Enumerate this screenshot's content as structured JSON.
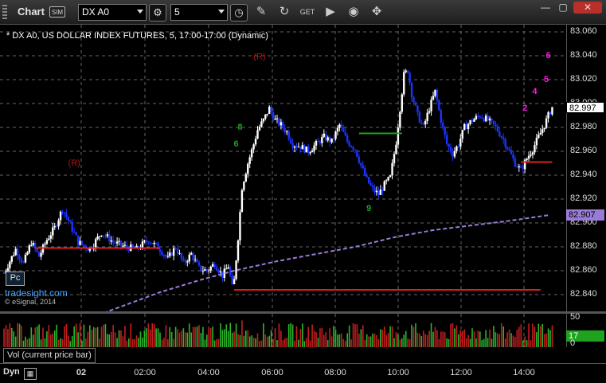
{
  "toolbar": {
    "title": "Chart",
    "sim_badge": "SIM",
    "symbol": "DX A0",
    "interval": "5",
    "icons": [
      "grip-icon",
      "settings-icon",
      "time-template-icon",
      "draw-tool-icon",
      "link-icon",
      "get-icon",
      "play-icon",
      "nav-icon",
      "drag-icon"
    ],
    "window_controls": [
      "minimize-icon",
      "maximize-icon",
      "close-icon"
    ]
  },
  "chart_data": {
    "type": "candlestick",
    "title": "* DX A0, US DOLLAR INDEX FUTURES, 5, 17:00-17:00 (Dynamic)",
    "ylim": [
      82.826,
      83.066
    ],
    "yticks": [
      "83.060",
      "83.040",
      "83.020",
      "83.000",
      "82.980",
      "82.960",
      "82.940",
      "82.920",
      "82.900",
      "82.880",
      "82.860",
      "82.840"
    ],
    "xticks": [
      "02",
      "02:00",
      "04:00",
      "06:00",
      "08:00",
      "10:00",
      "12:00",
      "14:00"
    ],
    "last_price": "82.997",
    "ma_label": "82.907",
    "grid": true,
    "colors": {
      "up": "#ffffff",
      "down": "#1a33ff",
      "ma": "#9a7bd8",
      "support": "#e01c1c",
      "count_green": "#1fa31f",
      "count_magenta": "#ff1ae8",
      "marker_red": "#b01313"
    },
    "price_path": [
      [
        0,
        82.858
      ],
      [
        6,
        82.878
      ],
      [
        10,
        82.866
      ],
      [
        14,
        82.884
      ],
      [
        18,
        82.872
      ],
      [
        22,
        82.886
      ],
      [
        26,
        82.896
      ],
      [
        30,
        82.912
      ],
      [
        33,
        82.902
      ],
      [
        38,
        82.884
      ],
      [
        44,
        82.878
      ],
      [
        50,
        82.892
      ],
      [
        56,
        82.884
      ],
      [
        62,
        82.88
      ],
      [
        68,
        82.878
      ],
      [
        74,
        82.886
      ],
      [
        80,
        82.878
      ],
      [
        84,
        82.87
      ],
      [
        88,
        82.88
      ],
      [
        92,
        82.866
      ],
      [
        96,
        82.874
      ],
      [
        100,
        82.862
      ],
      [
        104,
        82.86
      ],
      [
        108,
        82.866
      ],
      [
        112,
        82.856
      ],
      [
        115,
        82.864
      ],
      [
        117,
        82.846
      ],
      [
        118,
        82.852
      ],
      [
        120,
        82.888
      ],
      [
        122,
        82.93
      ],
      [
        125,
        82.95
      ],
      [
        128,
        82.966
      ],
      [
        130,
        82.978
      ],
      [
        133,
        82.986
      ],
      [
        136,
        82.996
      ],
      [
        139,
        82.986
      ],
      [
        142,
        82.982
      ],
      [
        145,
        82.976
      ],
      [
        148,
        82.966
      ],
      [
        152,
        82.964
      ],
      [
        156,
        82.96
      ],
      [
        160,
        82.966
      ],
      [
        164,
        82.972
      ],
      [
        168,
        82.968
      ],
      [
        172,
        82.982
      ],
      [
        176,
        82.968
      ],
      [
        180,
        82.962
      ],
      [
        183,
        82.948
      ],
      [
        186,
        82.936
      ],
      [
        189,
        82.928
      ],
      [
        192,
        82.924
      ],
      [
        195,
        82.932
      ],
      [
        198,
        82.938
      ],
      [
        201,
        82.968
      ],
      [
        203,
        82.996
      ],
      [
        205,
        83.024
      ],
      [
        207,
        83.028
      ],
      [
        209,
        83.008
      ],
      [
        212,
        82.99
      ],
      [
        215,
        82.98
      ],
      [
        218,
        82.996
      ],
      [
        221,
        83.01
      ],
      [
        224,
        82.986
      ],
      [
        227,
        82.966
      ],
      [
        230,
        82.958
      ],
      [
        233,
        82.966
      ],
      [
        236,
        82.98
      ],
      [
        240,
        82.986
      ],
      [
        244,
        82.99
      ],
      [
        248,
        82.986
      ],
      [
        252,
        82.98
      ],
      [
        256,
        82.97
      ],
      [
        259,
        82.96
      ],
      [
        262,
        82.95
      ],
      [
        265,
        82.944
      ],
      [
        268,
        82.954
      ],
      [
        271,
        82.962
      ],
      [
        274,
        82.972
      ],
      [
        277,
        82.982
      ],
      [
        279,
        82.99
      ],
      [
        281,
        82.997
      ]
    ],
    "moving_average": [
      [
        0,
        82.808
      ],
      [
        20,
        82.812
      ],
      [
        40,
        82.818
      ],
      [
        60,
        82.83
      ],
      [
        80,
        82.842
      ],
      [
        100,
        82.852
      ],
      [
        118,
        82.86
      ],
      [
        140,
        82.868
      ],
      [
        160,
        82.874
      ],
      [
        180,
        82.88
      ],
      [
        200,
        82.888
      ],
      [
        220,
        82.894
      ],
      [
        240,
        82.898
      ],
      [
        260,
        82.902
      ],
      [
        281,
        82.907
      ]
    ],
    "support_lines": [
      {
        "from": 16,
        "to": 80,
        "y": 82.879
      },
      {
        "from": 118,
        "to": 275,
        "y": 82.844
      },
      {
        "from": 265,
        "to": 281,
        "y": 82.951
      }
    ],
    "resistance_lines": [
      {
        "from": 182,
        "to": 204,
        "y": 82.975
      }
    ],
    "markers": [
      {
        "label": "(R)",
        "x": 36,
        "y": 82.948,
        "color": "marker_red"
      },
      {
        "label": "(R)",
        "x": 131,
        "y": 83.037,
        "color": "marker_red"
      }
    ],
    "count_labels": [
      {
        "label": "6",
        "x": 279,
        "y": 83.038,
        "color": "count_magenta"
      },
      {
        "label": "5",
        "x": 278,
        "y": 83.018,
        "color": "count_magenta"
      },
      {
        "label": "4",
        "x": 272,
        "y": 83.008,
        "color": "count_magenta"
      },
      {
        "label": "2",
        "x": 267,
        "y": 82.994,
        "color": "count_magenta"
      },
      {
        "label": "8",
        "x": 121,
        "y": 82.978,
        "color": "count_green"
      },
      {
        "label": "6",
        "x": 119,
        "y": 82.964,
        "color": "count_green"
      },
      {
        "label": "9",
        "x": 187,
        "y": 82.91,
        "color": "count_green"
      }
    ],
    "volume": {
      "ylim": [
        0,
        50
      ],
      "yticks": [
        "50",
        "0"
      ],
      "current": "17",
      "label": "Vol (current price bar)"
    }
  },
  "panels": {
    "pc_button": "Pc",
    "credit_site": "tradesight.com",
    "credit_copyright": "© eSignal, 2014",
    "dyn_label": "Dyn"
  }
}
